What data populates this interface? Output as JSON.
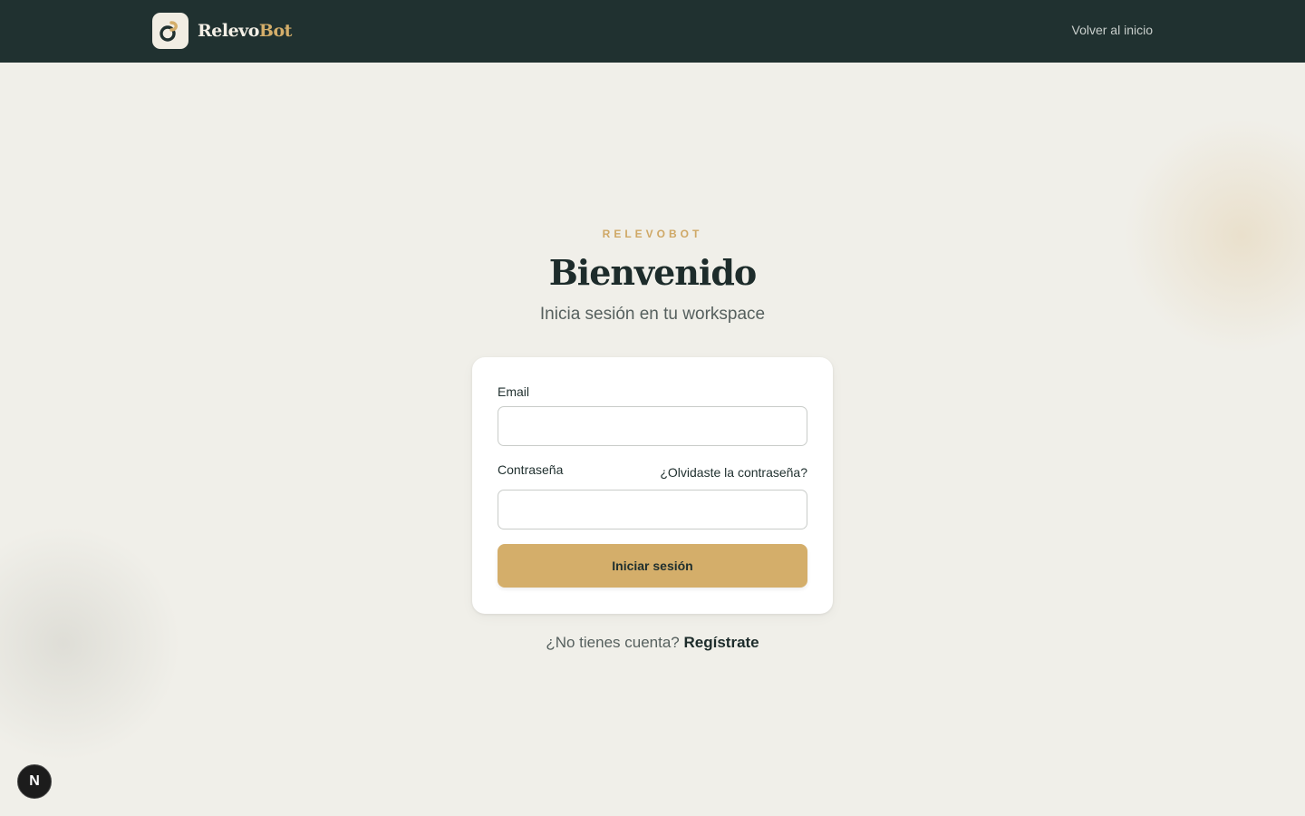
{
  "header": {
    "brand_part1": "Relevo",
    "brand_part2": "Bot",
    "back_link": "Volver al inicio"
  },
  "hero": {
    "eyebrow": "RELEVOBOT",
    "title": "Bienvenido",
    "subtitle": "Inicia sesión en tu workspace"
  },
  "form": {
    "email_label": "Email",
    "email_value": "",
    "password_label": "Contraseña",
    "password_value": "",
    "forgot_link": "¿Olvidaste la contraseña?",
    "submit_label": "Iniciar sesión"
  },
  "footer": {
    "no_account": "¿No tienes cuenta?",
    "register_link": "Regístrate"
  },
  "badge": {
    "letter": "N"
  },
  "colors": {
    "topbar": "#203130",
    "accent": "#d4ae6a",
    "background": "#f0efe9"
  },
  "icons": {
    "logo": "relevobot-logo-icon"
  }
}
